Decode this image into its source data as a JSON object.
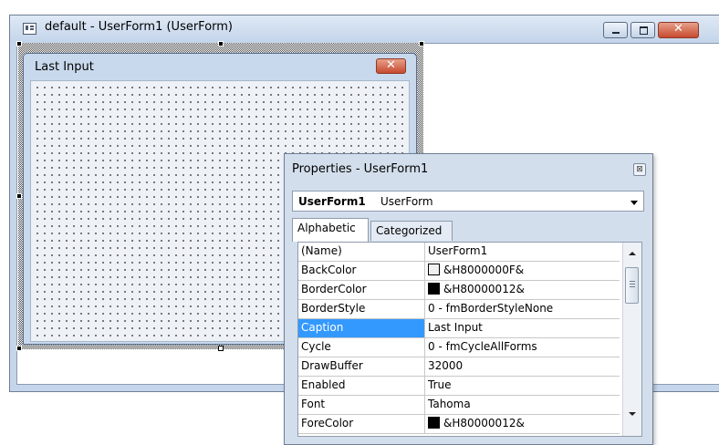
{
  "window": {
    "title": "default - UserForm1 (UserForm)",
    "buttons": {
      "minimize": "minimize",
      "maximize": "maximize",
      "close": "✕"
    }
  },
  "userform": {
    "caption": "Last Input",
    "close_glyph": "✕"
  },
  "properties": {
    "title": "Properties - UserForm1",
    "close_glyph": "⊠",
    "object": {
      "name": "UserForm1",
      "type": "UserForm"
    },
    "tabs": [
      {
        "label": "Alphabetic",
        "active": true
      },
      {
        "label": "Categorized",
        "active": false
      }
    ],
    "rows": [
      {
        "name": "(Name)",
        "value": "UserForm1"
      },
      {
        "name": "BackColor",
        "value": "&H8000000F&",
        "swatch": "#f0f0f0"
      },
      {
        "name": "BorderColor",
        "value": "&H80000012&",
        "swatch": "#000000"
      },
      {
        "name": "BorderStyle",
        "value": "0 - fmBorderStyleNone"
      },
      {
        "name": "Caption",
        "value": "Last Input",
        "selected": true
      },
      {
        "name": "Cycle",
        "value": "0 - fmCycleAllForms"
      },
      {
        "name": "DrawBuffer",
        "value": "32000"
      },
      {
        "name": "Enabled",
        "value": "True"
      },
      {
        "name": "Font",
        "value": "Tahoma"
      },
      {
        "name": "ForeColor",
        "value": "&H80000012&",
        "swatch": "#000000"
      }
    ]
  },
  "colors": {
    "selection": "#3399ff",
    "title_bar": "#c6d6ea",
    "close_button": "#c74a30"
  }
}
